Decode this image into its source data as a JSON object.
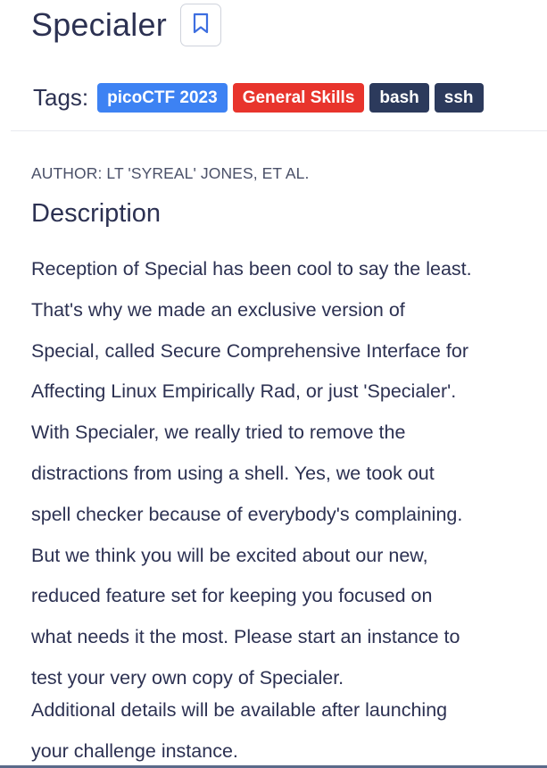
{
  "challenge": {
    "title": "Specialer",
    "bookmark_icon": "bookmark-icon"
  },
  "tags": {
    "label": "Tags:",
    "items": [
      {
        "label": "picoCTF 2023",
        "color": "#3d82f3"
      },
      {
        "label": "General Skills",
        "color": "#e8342c"
      },
      {
        "label": "bash",
        "color": "#2c3a5c"
      },
      {
        "label": "ssh",
        "color": "#2c3a5c"
      }
    ]
  },
  "author": "AUTHOR: LT 'SYREAL' JONES, ET AL.",
  "description": {
    "heading": "Description",
    "lines": [
      "Reception of Special has been cool to say the least.",
      "That's why we made an exclusive version of",
      "Special, called Secure Comprehensive Interface for",
      "Affecting Linux Empirically Rad, or just 'Specialer'.",
      "With Specialer, we really tried to remove the",
      "distractions from using a shell. Yes, we took out",
      "spell checker because of everybody's complaining.",
      "But we think you will be excited about our new,",
      "reduced feature set for keeping you focused on",
      "what needs it the most. Please start an instance to",
      "test your very own copy of Specialer."
    ],
    "additional_lines": [
      "Additional details will be available after launching",
      "your challenge instance."
    ]
  }
}
